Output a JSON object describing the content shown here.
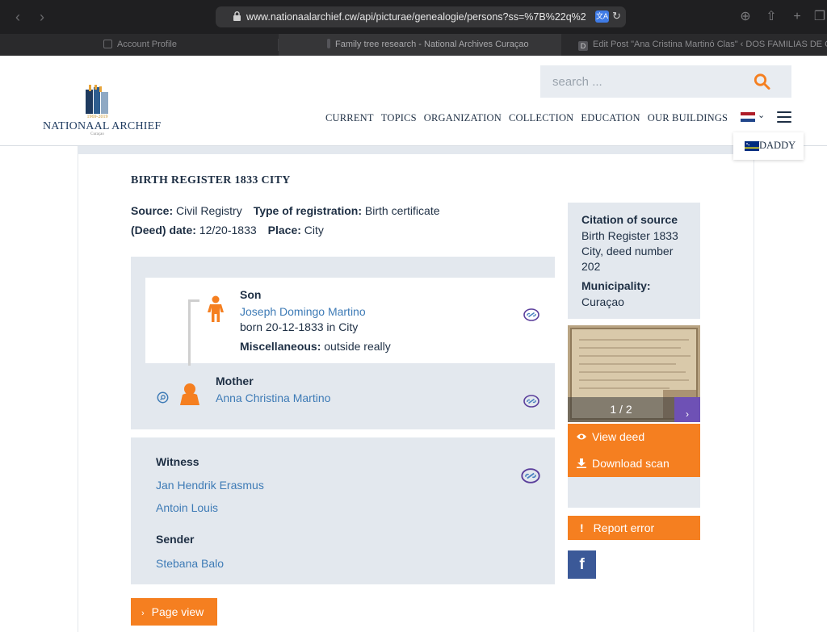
{
  "browser": {
    "url": "www.nationaalarchief.cw/api/picturae/genealogie/persons?ss=%7B%22q%22:%2",
    "tabs": [
      {
        "label": "Account Profile"
      },
      {
        "label": "Family tree research - National Archives Curaçao"
      },
      {
        "label": "Edit Post \"Ana Cristina Martinó Clas\" ‹ DOS FAMILIAS DE CATA..."
      }
    ],
    "third_tab_favicon": "D"
  },
  "header": {
    "logo_years": "1969-2019",
    "logo_name": "NATIONAAL ARCHIEF",
    "logo_sub": "Curaçao",
    "search_placeholder": "search ...",
    "nav": [
      {
        "label": "CURRENT"
      },
      {
        "label": "TOPICS"
      },
      {
        "label": "ORGANIZATION"
      },
      {
        "label": "COLLECTION"
      },
      {
        "label": "EDUCATION"
      },
      {
        "label": "OUR BUILDINGS"
      }
    ],
    "language_option": "DADDY",
    "colors": {
      "accent": "#f57f20",
      "navy": "#1e2f44"
    }
  },
  "record": {
    "title": "BIRTH REGISTER 1833 CITY",
    "source_label": "Source:",
    "source_value": "Civil Registry",
    "type_label": "Type of registration:",
    "type_value": "Birth certificate",
    "date_label": "(Deed) date:",
    "date_value": "12/20-1833",
    "place_label": "Place:",
    "place_value": "City"
  },
  "son": {
    "role": "Son",
    "name": "Joseph Domingo Martino",
    "born": "born 20-12-1833 in City",
    "misc_label": "Miscellaneous:",
    "misc_value": "outside really"
  },
  "mother": {
    "role": "Mother",
    "name": "Anna Christina Martino"
  },
  "witness": {
    "role": "Witness",
    "names": [
      "Jan Hendrik Erasmus",
      "Antoin Louis"
    ]
  },
  "sender": {
    "role": "Sender",
    "name": "Stebana Balo"
  },
  "citation": {
    "label": "Citation of source",
    "text": "Birth Register 1833 City, deed number 202",
    "municipality_label": "Municipality:",
    "municipality_value": "Curaçao"
  },
  "scan": {
    "counter": "1 / 2"
  },
  "actions": {
    "view_deed": "View deed",
    "download_scan": "Download scan",
    "report_error": "Report error",
    "page_view": "Page view",
    "facebook": "f"
  }
}
